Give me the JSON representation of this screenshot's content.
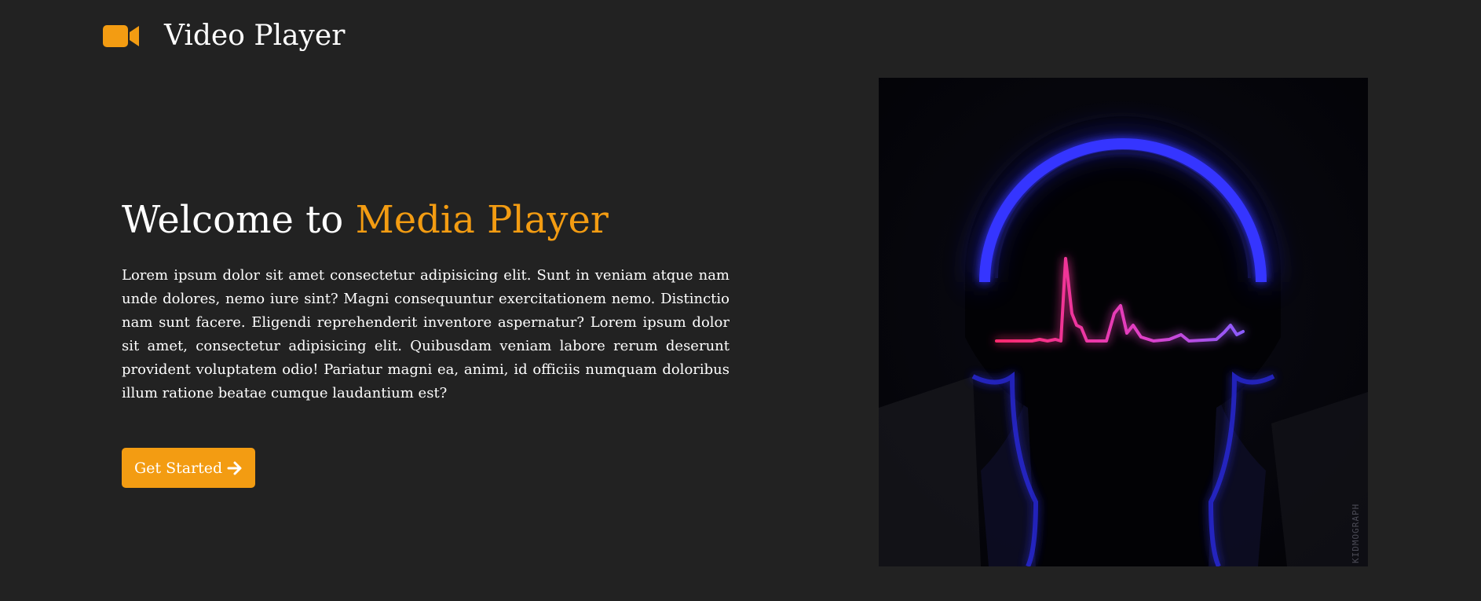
{
  "navbar": {
    "brand_icon": "video-camera-icon",
    "brand_text": "Video Player"
  },
  "hero": {
    "title_prefix": "Welcome to",
    "title_accent": "Media Player",
    "paragraph": "Lorem ipsum dolor sit amet consectetur adipisicing elit. Sunt in veniam atque nam unde dolores, nemo iure sint? Magni consequuntur exercitationem nemo. Distinctio nam sunt facere. Eligendi reprehenderit inventore aspernatur? Lorem ipsum dolor sit amet, consectetur adipisicing elit. Quibusdam veniam labore rerum deserunt provident voluptatem odio! Pariatur magni ea, animi, id officiis numquam doloribus illum ratione beatae cumque laudantium est?",
    "cta_label": "Get Started",
    "cta_icon": "arrow-right-icon",
    "image": "headphones-heartbeat-illustration",
    "image_watermark": "KIDMOGRAPH"
  },
  "colors": {
    "background": "#222222",
    "accent": "#f39c12",
    "text": "#ffffff",
    "headphone_glow": "#2a2ae6",
    "wave_start": "#ff2a6d",
    "wave_end": "#8a5cff"
  }
}
